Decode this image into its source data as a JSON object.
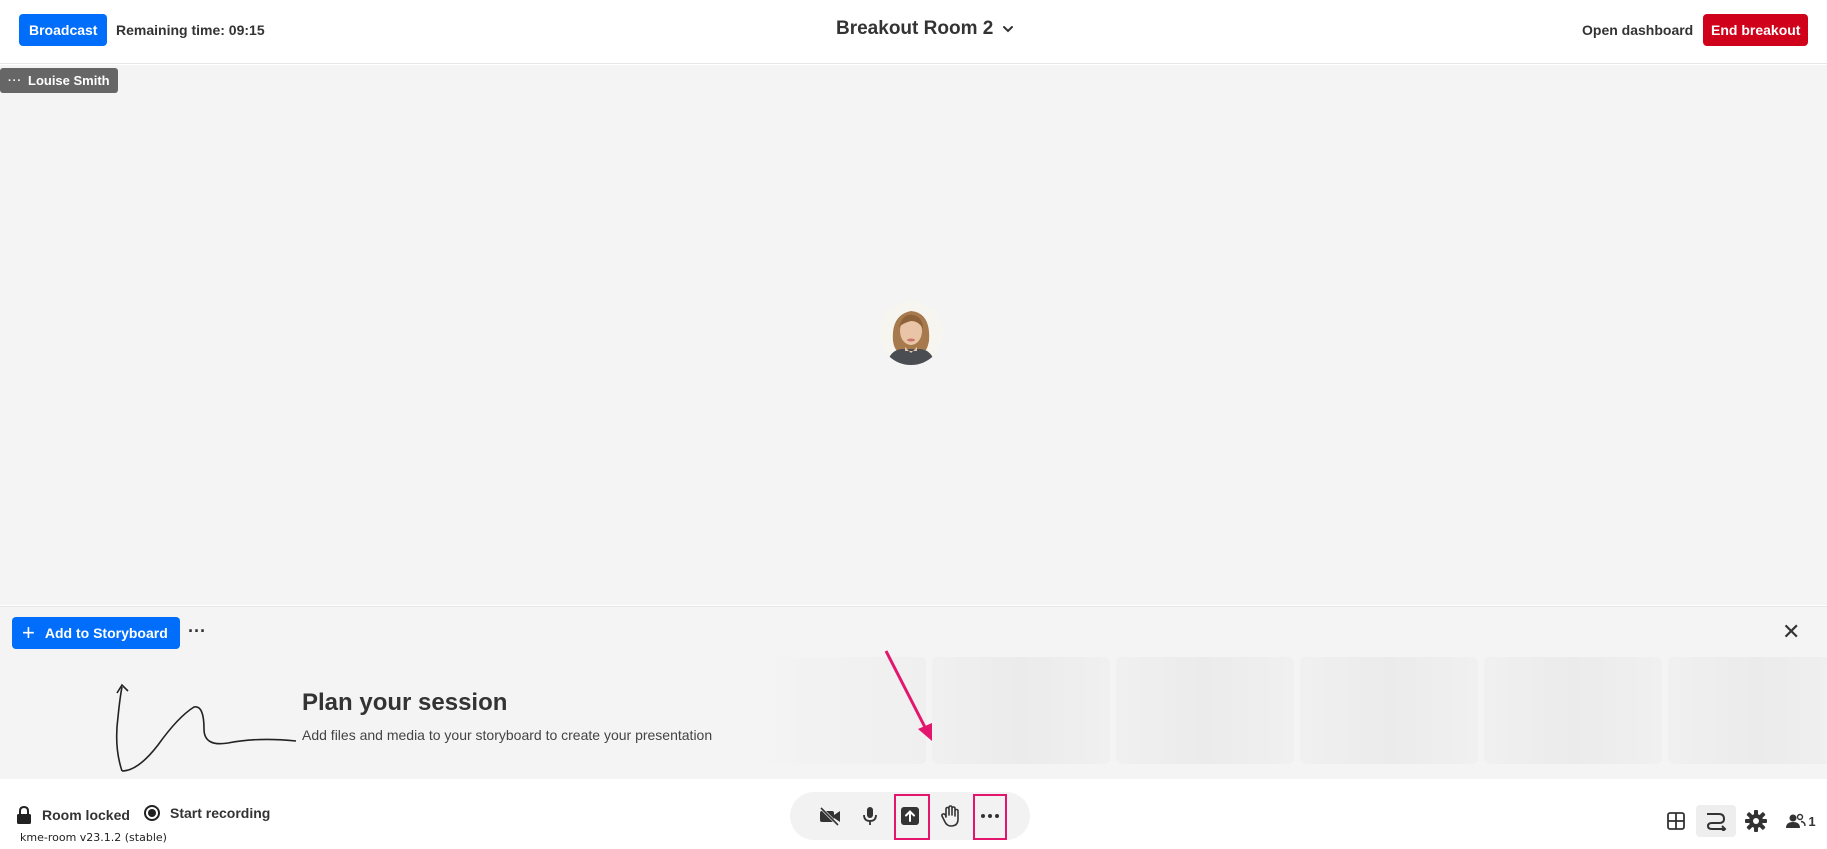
{
  "header": {
    "broadcast_label": "Broadcast",
    "remaining_time": "Remaining time: 09:15",
    "room_title": "Breakout Room 2",
    "open_dashboard_label": "Open dashboard",
    "end_breakout_label": "End breakout"
  },
  "stage": {
    "participant_name": "Louise Smith",
    "name_tag_menu": "···"
  },
  "storyboard": {
    "add_label": "Add to Storyboard",
    "more_label": "···",
    "close_label": "✕",
    "plan_title": "Plan your session",
    "plan_subtitle": "Add files and media to your storyboard to create your presentation"
  },
  "footer": {
    "room_locked_label": "Room locked",
    "start_recording_label": "Start recording",
    "version": "kme-room v23.1.2 (stable)",
    "participant_count": "1"
  },
  "icons": {
    "camera": "camera-off-icon",
    "mic": "microphone-icon",
    "share": "share-upload-icon",
    "hand": "raise-hand-icon",
    "more": "more-icon",
    "grid": "grid-layout-icon",
    "route": "route-icon",
    "settings": "gear-icon",
    "people": "participants-icon"
  },
  "colors": {
    "primary": "#006efa",
    "danger": "#d0021b",
    "annotation": "#e3166d"
  }
}
